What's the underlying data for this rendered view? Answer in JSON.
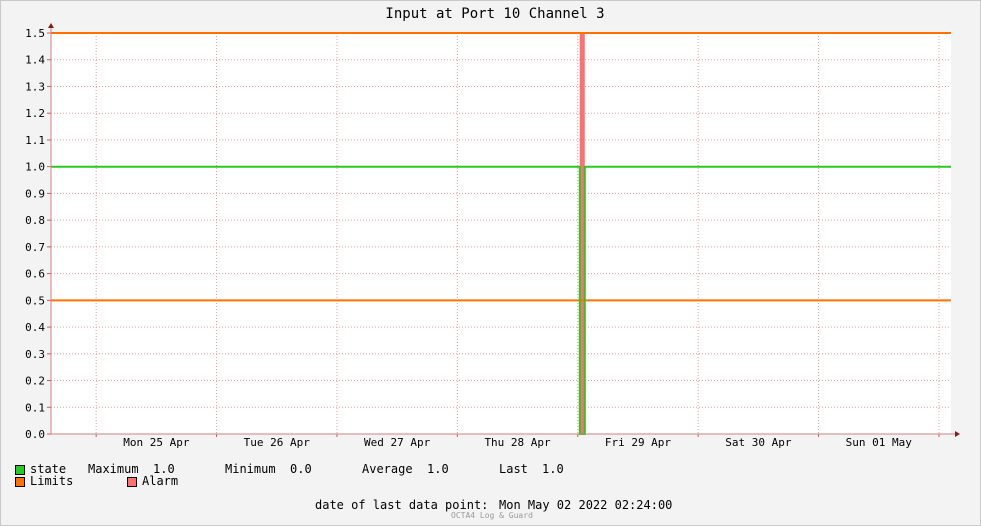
{
  "chart_data": {
    "type": "line",
    "title": "Input at Port 10 Channel 3",
    "ylim": [
      0,
      1.5
    ],
    "y_ticks": [
      "0.0",
      "0.1",
      "0.2",
      "0.3",
      "0.4",
      "0.5",
      "0.6",
      "0.7",
      "0.8",
      "0.9",
      "1.0",
      "1.1",
      "1.2",
      "1.3",
      "1.4",
      "1.5"
    ],
    "x_range": [
      "2022-04-24 15:00",
      "2022-05-02 02:24"
    ],
    "x_tick_labels": [
      "Mon 25 Apr",
      "Tue 26 Apr",
      "Wed 27 Apr",
      "Thu 28 Apr",
      "Fri 29 Apr",
      "Sat 30 Apr",
      "Sun 01 May"
    ],
    "x_tick_times": [
      "2022-04-25 12:00",
      "2022-04-26 12:00",
      "2022-04-27 12:00",
      "2022-04-28 12:00",
      "2022-04-29 12:00",
      "2022-04-30 12:00",
      "2022-05-01 12:00"
    ],
    "x_grid_times": [
      "2022-04-25 00:00",
      "2022-04-26 00:00",
      "2022-04-27 00:00",
      "2022-04-28 00:00",
      "2022-04-29 00:00",
      "2022-04-30 00:00",
      "2022-05-01 00:00",
      "2022-05-02 00:00"
    ],
    "grid": true,
    "series": [
      {
        "name": "state",
        "color": "#22cc22",
        "points": [
          [
            "2022-04-24 15:00",
            1.0
          ],
          [
            "2022-04-29 00:24",
            1.0
          ],
          [
            "2022-04-29 00:24",
            0.0
          ],
          [
            "2022-04-29 01:24",
            0.0
          ],
          [
            "2022-04-29 01:24",
            1.0
          ],
          [
            "2022-05-02 02:24",
            1.0
          ]
        ]
      }
    ],
    "limits": {
      "name": "Limits",
      "color": "#ff7000",
      "values": [
        0.5,
        1.5
      ]
    },
    "alarm": {
      "name": "Alarm",
      "color": "#ff7070",
      "start": "2022-04-29 00:24",
      "end": "2022-04-29 01:24"
    }
  },
  "legend": {
    "state_label": "state",
    "stats": [
      {
        "label": "Maximum",
        "value": "1.0"
      },
      {
        "label": "Minimum",
        "value": "0.0"
      },
      {
        "label": "Average",
        "value": "1.0"
      },
      {
        "label": "Last",
        "value": "1.0"
      }
    ],
    "limits_label": "Limits",
    "alarm_label": "Alarm"
  },
  "footer": {
    "label": "date of last data point:",
    "value": "Mon May 02 2022 02:24:00",
    "credit": "OCTA4 Log & Guard"
  }
}
